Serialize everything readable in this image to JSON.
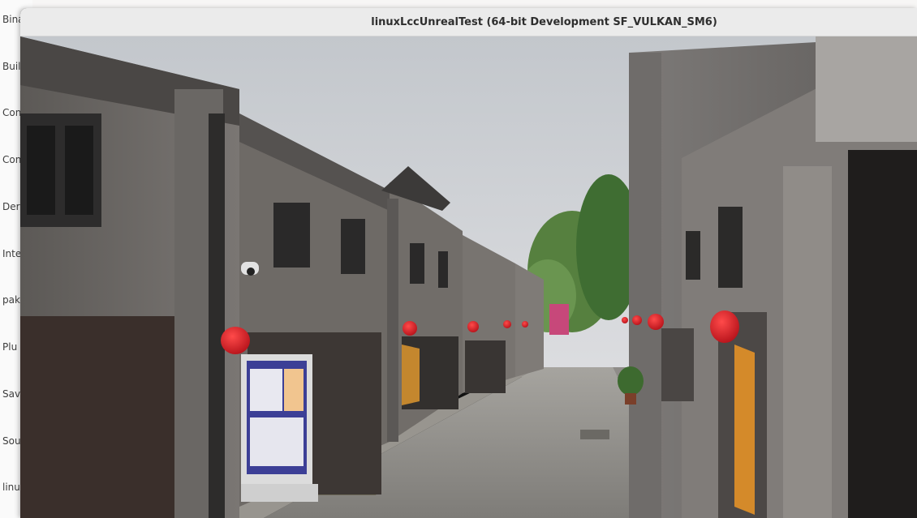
{
  "background_window": {
    "items": [
      {
        "label": "Bina"
      },
      {
        "label": "Buil"
      },
      {
        "label": "Con"
      },
      {
        "label": "Con"
      },
      {
        "label": "Der"
      },
      {
        "label": "Inte"
      },
      {
        "label": "pak"
      },
      {
        "label": "Plu"
      },
      {
        "label": "Sav"
      },
      {
        "label": "Sou"
      },
      {
        "label": "linu"
      }
    ]
  },
  "game_window": {
    "title": "linuxLccUnrealTest (64-bit Development SF_VULKAN_SM6)"
  },
  "viewport": {
    "scene_description_icon": "rendered-3d-street-scene",
    "colors": {
      "sky": "#c9ccd0",
      "stone": "#6d6a68",
      "lantern": "#d91e24",
      "tree": "#4d7a3a",
      "pavement": "#8d8c88"
    }
  }
}
